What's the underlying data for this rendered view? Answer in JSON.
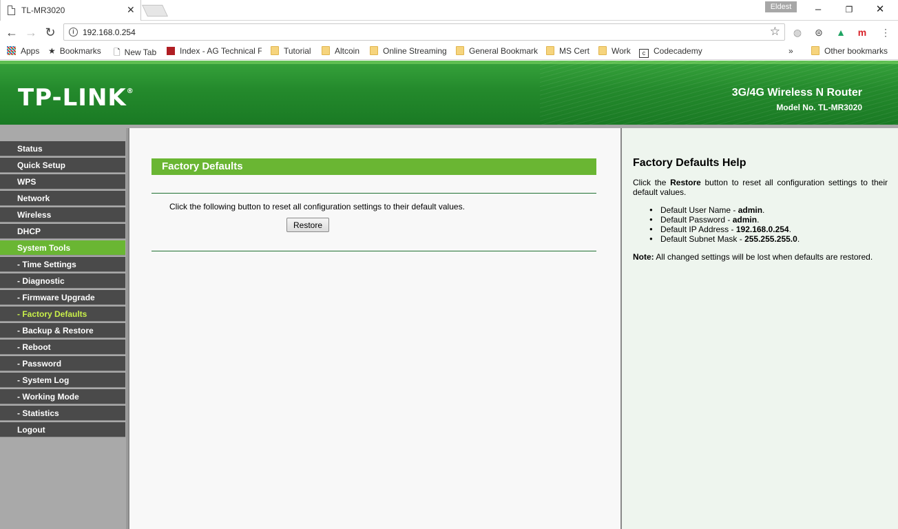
{
  "browser": {
    "tab_title": "TL-MR3020",
    "profile_name": "Eldest",
    "url": "192.168.0.254",
    "bookmarks": {
      "apps": "Apps",
      "bookmarks": "Bookmarks",
      "new_tab": "New Tab",
      "index": "Index - AG Technical F",
      "tutorial": "Tutorial",
      "altcoin": "Altcoin",
      "online_streaming": "Online Streaming",
      "general_bookmark": "General Bookmark",
      "ms_cert": "MS Cert",
      "work": "Work",
      "codecademy": "Codecademy",
      "more": "»",
      "other_bookmarks": "Other bookmarks"
    }
  },
  "header": {
    "logo": "TP-LINK",
    "logo_mark": "®",
    "product_name": "3G/4G Wireless N Router",
    "model_no": "Model No. TL-MR3020"
  },
  "menu": {
    "status": "Status",
    "quick_setup": "Quick Setup",
    "wps": "WPS",
    "network": "Network",
    "wireless": "Wireless",
    "dhcp": "DHCP",
    "system_tools": "System Tools",
    "time_settings": "- Time Settings",
    "diagnostic": "- Diagnostic",
    "firmware_upgrade": "- Firmware Upgrade",
    "factory_defaults": "- Factory Defaults",
    "backup_restore": "- Backup & Restore",
    "reboot": "- Reboot",
    "password": "- Password",
    "system_log": "- System Log",
    "working_mode": "- Working Mode",
    "statistics": "- Statistics",
    "logout": "Logout"
  },
  "main": {
    "section_title": "Factory Defaults",
    "description": "Click the following button to reset all configuration settings to their default values.",
    "restore_button": "Restore"
  },
  "help": {
    "title": "Factory Defaults Help",
    "intro_prefix": "Click the ",
    "intro_bold": "Restore",
    "intro_suffix": " button to reset all configuration settings to their default values.",
    "items": [
      {
        "label": "Default User Name - ",
        "value": "admin",
        "end": "."
      },
      {
        "label": "Default Password - ",
        "value": "admin",
        "end": "."
      },
      {
        "label": "Default IP Address - ",
        "value": "192.168.0.254",
        "end": "."
      },
      {
        "label": "Default Subnet Mask - ",
        "value": "255.255.255.0",
        "end": "."
      }
    ],
    "note_label": "Note:",
    "note_text": " All changed settings will be lost when defaults are restored."
  }
}
